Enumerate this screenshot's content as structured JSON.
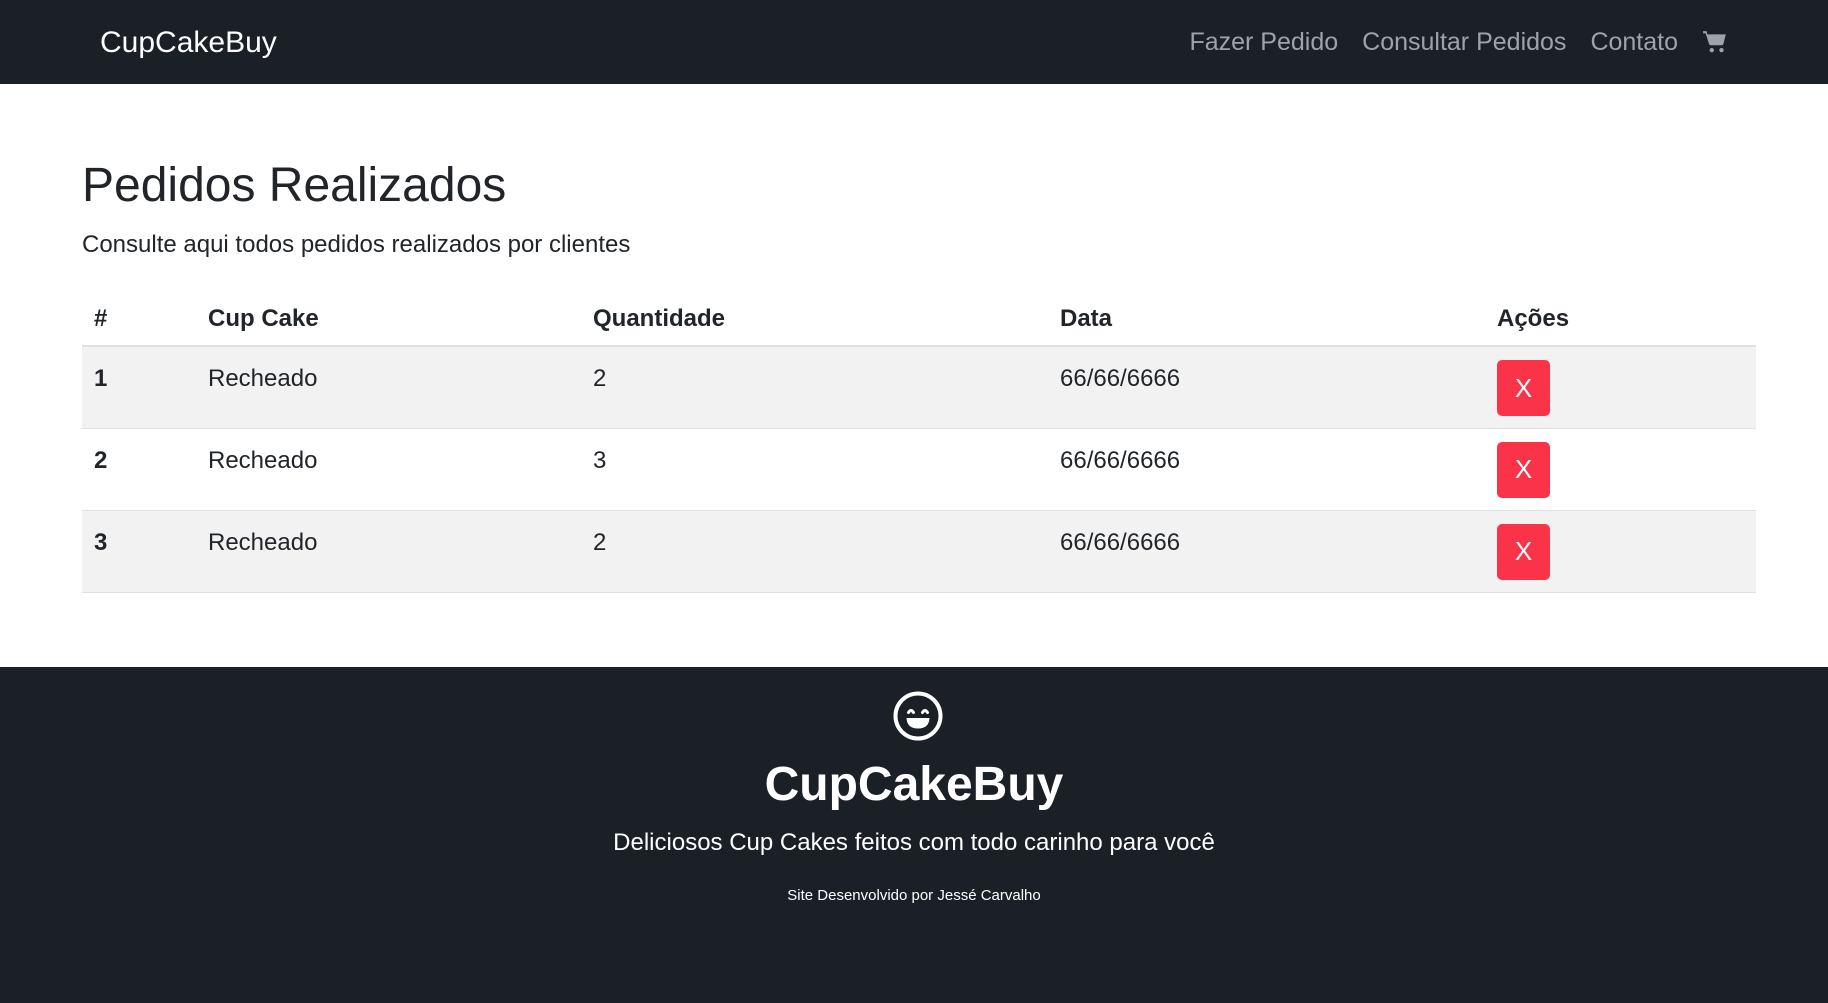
{
  "navbar": {
    "brand": "CupCakeBuy",
    "links": [
      "Fazer Pedido",
      "Consultar Pedidos",
      "Contato"
    ],
    "cart_icon": "shopping-cart-icon"
  },
  "main": {
    "title": "Pedidos Realizados",
    "subtitle": "Consulte aqui todos pedidos realizados por clientes",
    "table": {
      "headers": [
        "#",
        "Cup Cake",
        "Quantidade",
        "Data",
        "Ações"
      ],
      "rows": [
        {
          "id": "1",
          "cupcake": "Recheado",
          "quantidade": "2",
          "data": "66/66/6666",
          "action": "X"
        },
        {
          "id": "2",
          "cupcake": "Recheado",
          "quantidade": "3",
          "data": "66/66/6666",
          "action": "X"
        },
        {
          "id": "3",
          "cupcake": "Recheado",
          "quantidade": "2",
          "data": "66/66/6666",
          "action": "X"
        }
      ]
    }
  },
  "footer": {
    "icon": "smile-icon",
    "title": "CupCakeBuy",
    "tagline": "Deliciosos Cup Cakes feitos com todo carinho para você",
    "credit": "Site Desenvolvido por Jessé Carvalho"
  },
  "colors": {
    "navbar_bg": "#1b2027",
    "danger": "#fb3348",
    "stripe": "#f2f2f2",
    "nav_link": "#9da3a9"
  }
}
